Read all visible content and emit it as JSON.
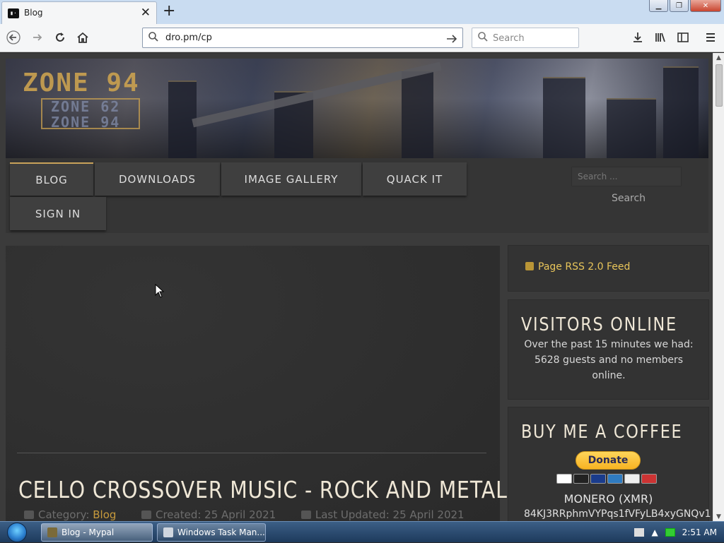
{
  "browser": {
    "tab_title": "Blog",
    "url": "dro.pm/cp",
    "search_placeholder": "Search",
    "window_buttons": {
      "minimize": "▁",
      "restore": "❐",
      "close": "✕"
    }
  },
  "site": {
    "logo_main": "ZONE 94",
    "logo_sub1": "ZONE 62",
    "logo_sub2": "ZONE 94",
    "menu": [
      {
        "label": "BLOG",
        "active": true
      },
      {
        "label": "DOWNLOADS"
      },
      {
        "label": "IMAGE GALLERY"
      },
      {
        "label": "QUACK IT"
      },
      {
        "label": "SIGN IN"
      }
    ],
    "search_placeholder": "Search ...",
    "search_button": "Search"
  },
  "article": {
    "title": "CELLO CROSSOVER MUSIC - ROCK AND METAL",
    "category_label": "Category:",
    "category": "Blog",
    "created": "Created: 25 April 2021",
    "updated": "Last Updated: 25 April 2021"
  },
  "sidebar": {
    "rss": "Page RSS 2.0 Feed",
    "visitors_title": "VISITORS ONLINE",
    "visitors_text": "Over the past 15 minutes we had: 5628 guests and no members online.",
    "coffee_title": "BUY ME A COFFEE",
    "donate_label": "Donate",
    "monero_label": "MONERO (XMR)",
    "monero_address": "84KJ3RRphmVYPqs1fVFyLB4xyGNQv1"
  },
  "taskbar": {
    "tasks": [
      {
        "label": "Blog - Mypal",
        "active": true
      },
      {
        "label": "Windows Task Man..."
      }
    ],
    "clock": "2:51 AM"
  },
  "colors": {
    "accent": "#c79a3c",
    "rss": "#e8c55a",
    "page_bg": "#3b3b3b"
  }
}
